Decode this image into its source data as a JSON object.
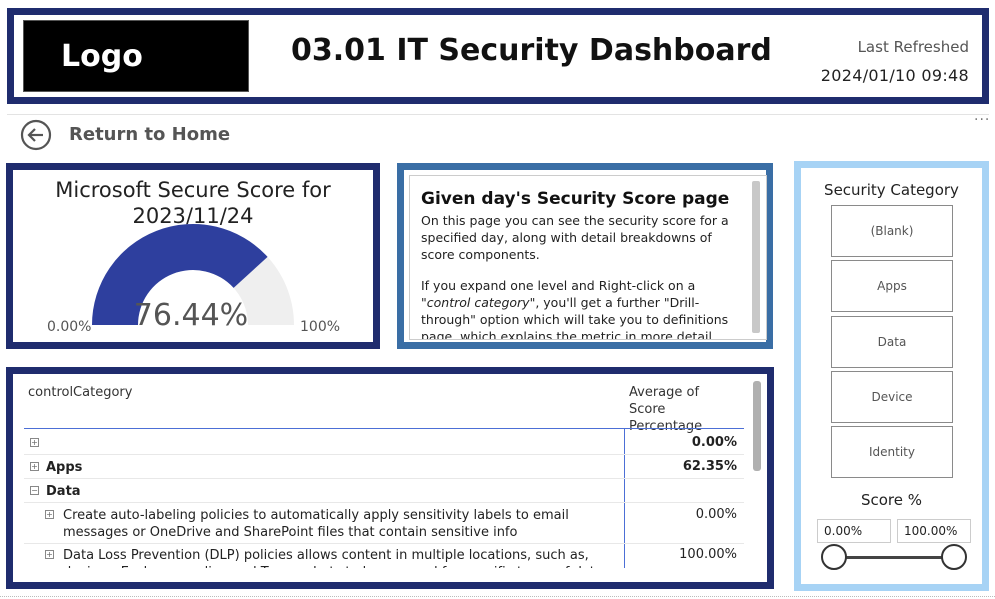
{
  "header": {
    "logo": "Logo",
    "title": "03.01 IT Security Dashboard",
    "last_refreshed_label": "Last Refreshed",
    "last_refreshed_value": "2024/01/10 09:48"
  },
  "nav": {
    "back_icon": "arrow-left-circle-icon",
    "home_label": "Return to Home",
    "more_icon": "ellipsis-icon"
  },
  "score_card": {
    "title_line1": "Microsoft Secure Score for",
    "title_line2": "2023/11/24",
    "value_label": "76.44%",
    "value": 76.44,
    "min_label": "0.00%",
    "max_label": "100%",
    "fill_color": "#2e3f9e",
    "track_color": "#efefef"
  },
  "info_card": {
    "title": "Given day's Security Score page",
    "p1": "On this page you can see the security score for a specified day, along with detail breakdowns of score components.",
    "p2_a": "If you expand one level and Right-click on a \"",
    "p2_em1": "control category",
    "p2_b": "\", you'll get a further \"Drill-through\" option which will take you to definitions page, which explains the metric in more detail."
  },
  "table": {
    "col_category": "controlCategory",
    "col_average": "Average of Score Percentage",
    "rows": [
      {
        "label": "",
        "value": "0.00%",
        "expand": "+"
      },
      {
        "label": "Apps",
        "value": "62.35%",
        "expand": "+"
      },
      {
        "label": "Data",
        "value": "",
        "expand": "−"
      },
      {
        "label": "Create auto-labeling policies to automatically apply sensitivity labels to email messages or OneDrive and SharePoint files that contain sensitive info",
        "value": "0.00%",
        "expand": "+"
      },
      {
        "label": "Data Loss Prevention (DLP) policies allows content in multiple locations, such as, devices, Exchange online and Teams chats to be scanned for specific types of data like social security",
        "value": "100.00%",
        "expand": "+"
      }
    ]
  },
  "slicer": {
    "title": "Security Category",
    "items": [
      "(Blank)",
      "Apps",
      "Data",
      "Device",
      "Identity"
    ],
    "range_title": "Score %",
    "range_min": "0.00%",
    "range_max": "100.00%"
  },
  "colors": {
    "navy_border": "#1f2c6e",
    "info_border": "#3a6ea5",
    "slicer_border": "#a7d3f5"
  }
}
